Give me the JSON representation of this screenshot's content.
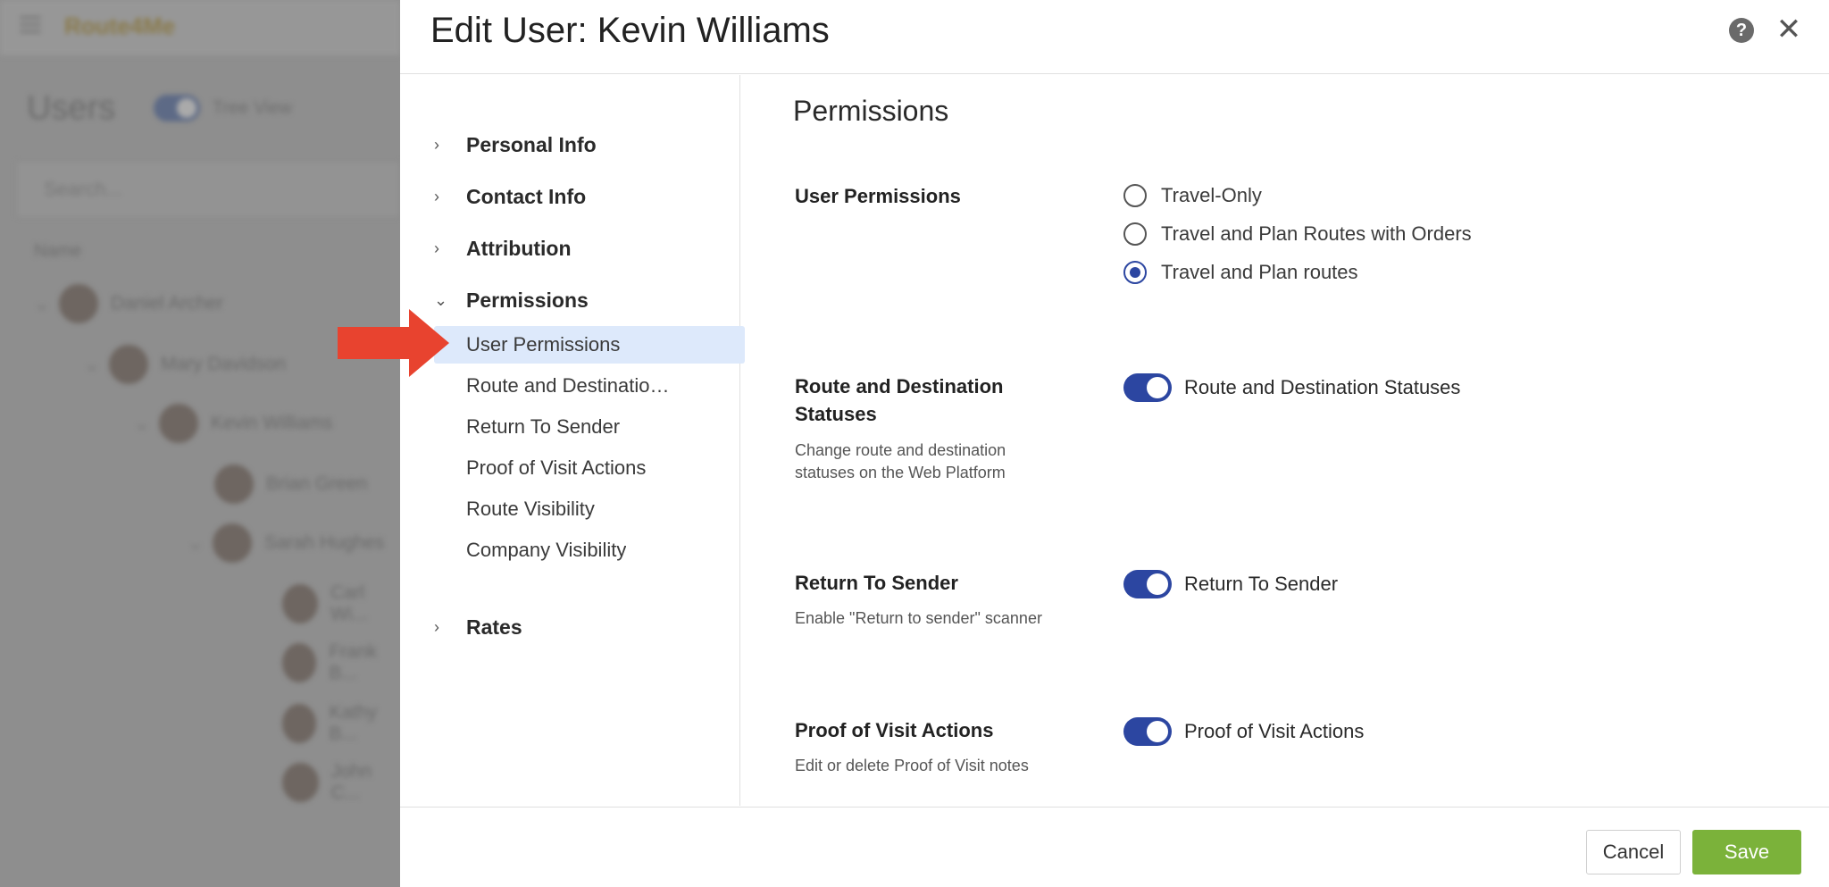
{
  "background": {
    "app_logo": "Route4Me",
    "page_title": "Users",
    "tree_view_label": "Tree View",
    "search_placeholder": "Search...",
    "column_name": "Name",
    "users": [
      "Daniel Archer",
      "Mary Davidson",
      "Kevin Williams",
      "Brian Green",
      "Sarah Hughes",
      "Carl Wi...",
      "Frank B...",
      "Kathy B...",
      "John C..."
    ]
  },
  "modal": {
    "title": "Edit User: Kevin Williams",
    "help_icon": "?",
    "close_icon": "✕"
  },
  "nav": {
    "sections": {
      "personal_info": "Personal Info",
      "contact_info": "Contact Info",
      "attribution": "Attribution",
      "permissions": "Permissions",
      "rates": "Rates"
    },
    "permission_items": [
      "User Permissions",
      "Route and Destination Statuses",
      "Return To Sender",
      "Proof of Visit Actions",
      "Route Visibility",
      "Company Visibility"
    ],
    "active_item": "User Permissions"
  },
  "content": {
    "section_title": "Permissions",
    "user_permissions": {
      "label": "User Permissions",
      "options": [
        "Travel-Only",
        "Travel and Plan Routes with Orders",
        "Travel and Plan routes"
      ],
      "selected": "Travel and Plan routes"
    },
    "route_statuses": {
      "label_line1": "Route and Destination",
      "label_line2": "Statuses",
      "desc_line1": "Change route and destination",
      "desc_line2": "statuses on the Web Platform",
      "toggle_label": "Route and Destination Statuses",
      "enabled": true
    },
    "return_to_sender": {
      "label": "Return To Sender",
      "desc": "Enable \"Return to sender\" scanner",
      "toggle_label": "Return To Sender",
      "enabled": true
    },
    "proof_of_visit": {
      "label": "Proof of Visit Actions",
      "desc": "Edit or delete Proof of Visit notes",
      "toggle_label": "Proof of Visit Actions",
      "enabled": true
    }
  },
  "footer": {
    "cancel_label": "Cancel",
    "save_label": "Save"
  },
  "colors": {
    "accent": "#2c46a1",
    "save_green": "#7bb23a",
    "arrow_red": "#e8432f",
    "active_nav_bg": "#dde9fb"
  }
}
